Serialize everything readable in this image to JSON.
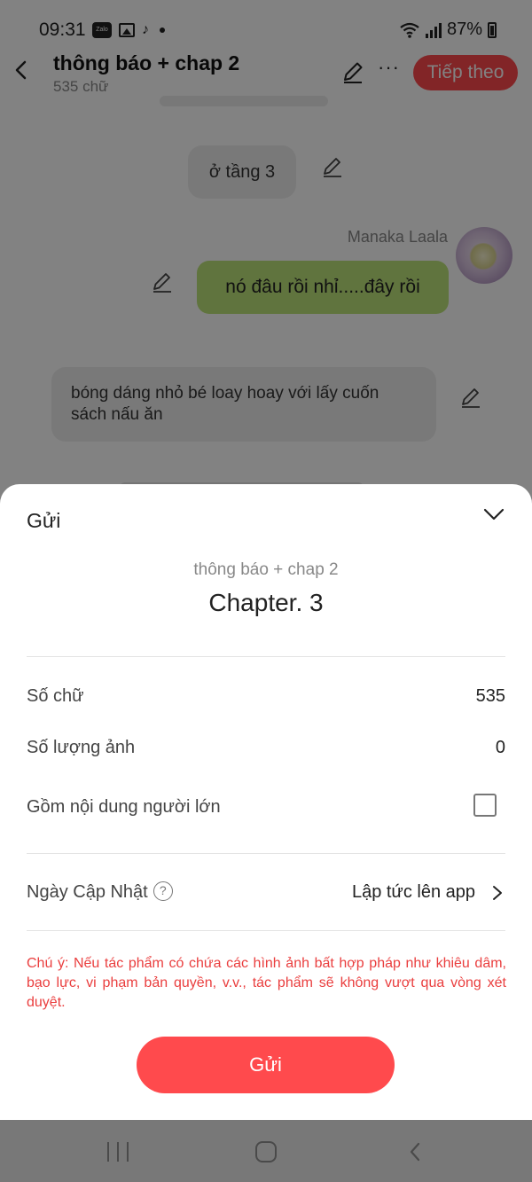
{
  "status_bar": {
    "time": "09:31",
    "app_badge": "Zalo",
    "tiktok_glyph": "♪",
    "battery": "87%"
  },
  "header": {
    "title": "thông báo + chap 2",
    "word_count": "535 chữ",
    "next_button": "Tiếp theo",
    "more_glyph": "···"
  },
  "chat": {
    "bubble_1": "ở tầng 3",
    "sender_name": "Manaka Laala",
    "bubble_2": "nó đâu rồi nhỉ.....đây rồi",
    "bubble_3": "bóng dáng nhỏ bé loay hoay với lấy cuốn sách nấu ăn"
  },
  "sheet": {
    "title": "Gửi",
    "book_title": "thông báo + chap 2",
    "chapter_title": "Chapter. 3",
    "rows": {
      "word_count_label": "Số chữ",
      "word_count_value": "535",
      "image_count_label": "Số lượng ảnh",
      "image_count_value": "0",
      "adult_label": "Gồm nội dung người lớn",
      "adult_checked": false,
      "update_label": "Ngày Cập Nhật",
      "help_glyph": "?",
      "update_value": "Lập tức lên app"
    },
    "warning": "Chú ý: Nếu tác phẩm có chứa các hình ảnh bất hợp pháp như khiêu dâm, bạo lực, vi phạm bản quyền, v.v., tác phẩm sẽ không vượt qua vòng xét duyệt.",
    "send_button": "Gửi"
  },
  "colors": {
    "accent": "#ff4a4d",
    "warning": "#ea3e3e",
    "bubble_green": "#bde37a"
  }
}
